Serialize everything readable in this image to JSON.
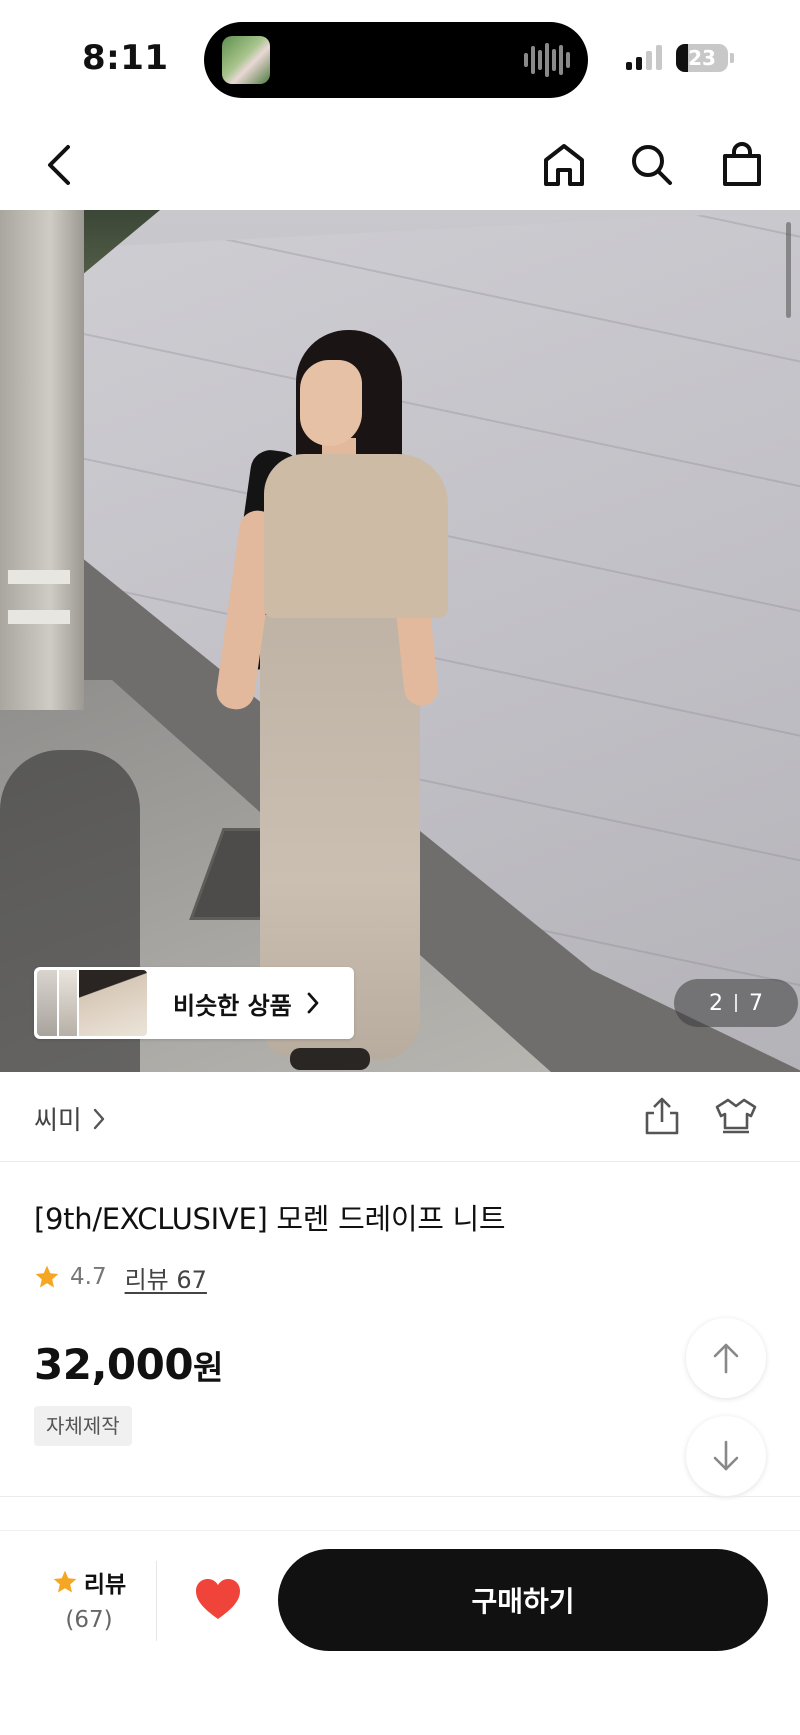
{
  "status_bar": {
    "time": "8:11",
    "battery": "23",
    "battery_level": 0.23
  },
  "nav": {
    "back_icon": "chevron-left-icon",
    "home_icon": "home-icon",
    "search_icon": "search-icon",
    "bag_icon": "shopping-bag-icon"
  },
  "hero": {
    "similar_label": "비슷한 상품",
    "pager_current": "2",
    "pager_total": "7"
  },
  "brand": {
    "name": "씨미"
  },
  "product": {
    "title": "[9th/EXCLUSIVE] 모렌 드레이프 니트",
    "rating": "4.7",
    "review_link": "리뷰 67",
    "price_number": "32,000",
    "price_unit": "원",
    "tag": "자체제작"
  },
  "bottom_bar": {
    "review_label": "리뷰",
    "review_count": "(67)",
    "buy_label": "구매하기"
  },
  "colors": {
    "star": "#F5A623",
    "heart": "#F0433A",
    "buy_button": "#111111"
  }
}
